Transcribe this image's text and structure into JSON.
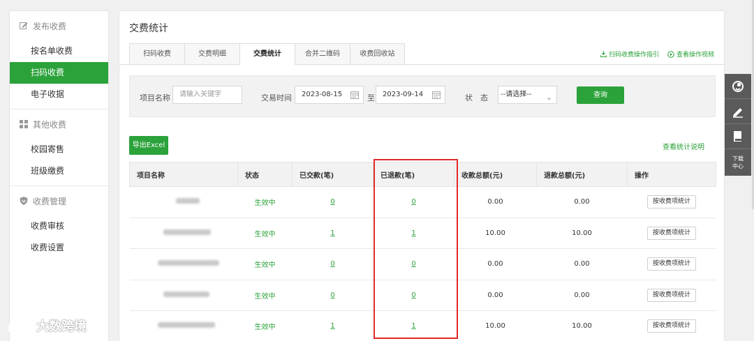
{
  "sidebar": {
    "groups": [
      {
        "label": "发布收费",
        "items": [
          {
            "label": "按名单收费"
          },
          {
            "label": "扫码收费"
          },
          {
            "label": "电子收据"
          }
        ]
      },
      {
        "label": "其他收费",
        "items": [
          {
            "label": "校园寄售"
          },
          {
            "label": "班级缴费"
          }
        ]
      },
      {
        "label": "收费管理",
        "items": [
          {
            "label": "收费审核"
          },
          {
            "label": "收费设置"
          }
        ]
      }
    ],
    "active_item": "扫码收费"
  },
  "main": {
    "title": "交费统计",
    "tabs": [
      {
        "label": "扫码收费"
      },
      {
        "label": "交费明细"
      },
      {
        "label": "交费统计"
      },
      {
        "label": "合并二维码"
      },
      {
        "label": "收费回收站"
      }
    ],
    "active_tab": "交费统计",
    "links": {
      "guide": "扫码收费操作指引",
      "video": "查看操作视频"
    }
  },
  "filter": {
    "project_label": "项目名称",
    "project_placeholder": "请输入关键字",
    "time_label": "交易时间",
    "date_from": "2023-08-15",
    "date_sep": "至",
    "date_to": "2023-09-14",
    "status_label": "状　态",
    "status_value": "--请选择--",
    "query_button": "查询"
  },
  "actions": {
    "export_button": "导出Excel",
    "explain_link": "查看统计说明"
  },
  "table": {
    "headers": [
      "项目名称",
      "状态",
      "已交款(笔)",
      "已退款(笔)",
      "收款总额(元)",
      "退款总额(元)",
      "操作"
    ],
    "rows": [
      {
        "status": "生效中",
        "paid": "0",
        "refunded": "0",
        "total": "0.00",
        "refund_total": "0.00",
        "op": "按收费项统计"
      },
      {
        "status": "生效中",
        "paid": "1",
        "refunded": "1",
        "total": "10.00",
        "refund_total": "10.00",
        "op": "按收费项统计"
      },
      {
        "status": "生效中",
        "paid": "0",
        "refunded": "0",
        "total": "0.00",
        "refund_total": "0.00",
        "op": "按收费项统计"
      },
      {
        "status": "生效中",
        "paid": "0",
        "refunded": "0",
        "total": "0.00",
        "refund_total": "0.00",
        "op": "按收费项统计"
      },
      {
        "status": "生效中",
        "paid": "1",
        "refunded": "1",
        "total": "10.00",
        "refund_total": "10.00",
        "op": "按收费项统计"
      }
    ]
  },
  "float_bar": {
    "download_label_1": "下载",
    "download_label_2": "中心"
  },
  "watermark": {
    "text": "大数跨境"
  },
  "colors": {
    "accent": "#2ba23a",
    "highlight": "#e02a2a"
  }
}
